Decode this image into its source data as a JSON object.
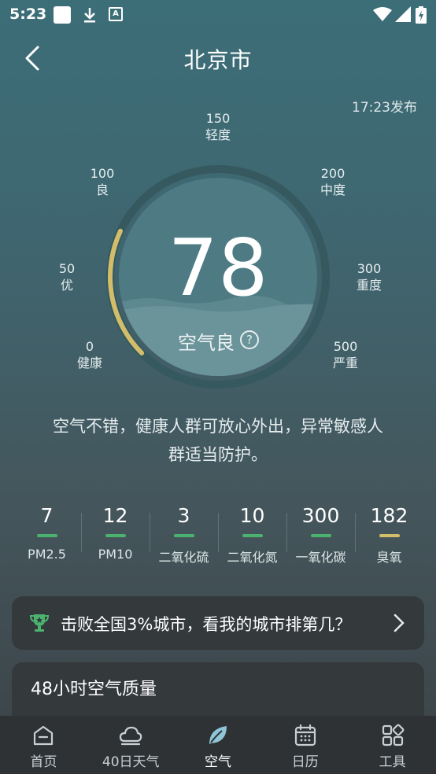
{
  "status_bar": {
    "time": "5:23"
  },
  "header": {
    "title": "北京市",
    "publish_time": "17:23发布"
  },
  "gauge": {
    "aqi": "78",
    "aqi_numeric": 78,
    "aqi_max": 500,
    "level": "空气良",
    "help": "?",
    "progress_color": "#d3bd6b",
    "scale": [
      {
        "value": "0",
        "label": "健康"
      },
      {
        "value": "50",
        "label": "优"
      },
      {
        "value": "100",
        "label": "良"
      },
      {
        "value": "150",
        "label": "轻度"
      },
      {
        "value": "200",
        "label": "中度"
      },
      {
        "value": "300",
        "label": "重度"
      },
      {
        "value": "500",
        "label": "严重"
      }
    ]
  },
  "advice": {
    "line1": "空气不错，健康人群可放心外出，异常敏感人",
    "line2": "群适当防护。"
  },
  "pollutants": [
    {
      "value": "7",
      "name": "PM2.5",
      "color": "#4bb36f"
    },
    {
      "value": "12",
      "name": "PM10",
      "color": "#4bb36f"
    },
    {
      "value": "3",
      "name": "二氧化硫",
      "color": "#4bb36f"
    },
    {
      "value": "10",
      "name": "二氧化氮",
      "color": "#4bb36f"
    },
    {
      "value": "300",
      "name": "一氧化碳",
      "color": "#4bb36f"
    },
    {
      "value": "182",
      "name": "臭氧",
      "color": "#d3bd6b"
    }
  ],
  "rank_banner": {
    "text": "击败全国3%城市，看我的城市排第几？",
    "icon": "trophy-icon",
    "accent": "#4bb36f"
  },
  "forecast_card": {
    "title": "48小时空气质量"
  },
  "bottom_nav": [
    {
      "label": "首页",
      "icon": "home-icon"
    },
    {
      "label": "40日天气",
      "icon": "cloud-icon"
    },
    {
      "label": "空气",
      "icon": "leaf-icon",
      "active": true
    },
    {
      "label": "日历",
      "icon": "calendar-icon"
    },
    {
      "label": "工具",
      "icon": "tools-icon"
    }
  ]
}
